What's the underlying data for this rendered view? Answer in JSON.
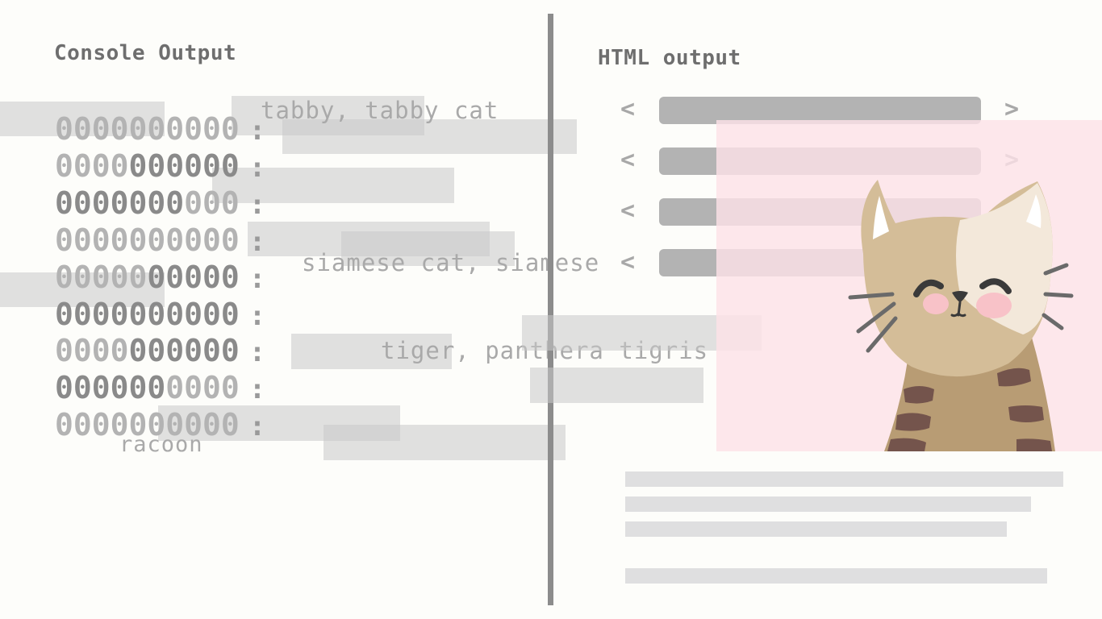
{
  "console": {
    "title": "Console Output",
    "rows": [
      {
        "light": "0000000000",
        "dark": "",
        "colon": ":"
      },
      {
        "light": "0000",
        "dark": "000000",
        "colon": ":"
      },
      {
        "light": "",
        "dark": "0000000",
        "rest": "000",
        "colon": ":"
      },
      {
        "light": "0000000000",
        "dark": "",
        "colon": ":"
      },
      {
        "light": "00000",
        "dark": "00000",
        "colon": ":"
      },
      {
        "light": "",
        "dark": "0000000000",
        "colon": ":"
      },
      {
        "light": "0000",
        "dark": "000000",
        "colon": ":"
      },
      {
        "light": "",
        "dark": "000000",
        "rest": "0000",
        "colon": ":"
      },
      {
        "light": "0000000000",
        "dark": "",
        "colon": ":"
      }
    ],
    "labels": {
      "tabby": "tabby, tabby cat",
      "siamese": "siamese cat, siamese",
      "tiger": "tiger, panthera tigris",
      "racoon": "racoon"
    }
  },
  "html_output": {
    "title": "HTML output",
    "left_chevron": "<",
    "right_chevron": ">"
  },
  "colors": {
    "background": "#fdfdfa",
    "divider": "#8c8c8c",
    "pink_panel": "#fce2e8",
    "cat_fur": "#d4bd98",
    "cat_stripes": "#74544c"
  }
}
